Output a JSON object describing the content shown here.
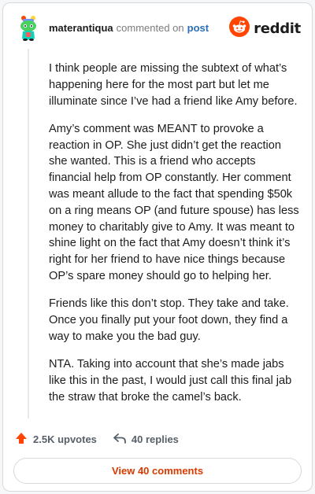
{
  "header": {
    "username": "materantiqua",
    "verb": "commented on",
    "post_link": "post",
    "brand": "reddit"
  },
  "comment": {
    "paragraphs": [
      "I think people are missing the subtext of what’s happening here for the most part but let me illuminate since I’ve had a friend like Amy before.",
      "Amy’s comment was MEANT to provoke a reaction in OP. She just didn’t get the reaction she wanted. This is a friend who accepts financial help from OP constantly. Her comment was meant allude to the fact that spending $50k on a ring means OP (and future spouse) has less money to charitably give to Amy. It was meant to shine light on the fact that Amy doesn’t think it’s right for her friend to have nice things because OP’s spare money should go to helping her.",
      "Friends like this don’t stop. They take and take. Once you finally put your foot down, they find a way to make you the bad guy.",
      "NTA. Taking into account that she’s made jabs like this in the past, I would just call this final jab the straw that broke the camel’s back."
    ]
  },
  "actions": {
    "upvotes": "2.5K upvotes",
    "replies": "40 replies",
    "view_comments": "View 40 comments"
  },
  "colors": {
    "accent": "#ff4500",
    "link": "#2b6fb8",
    "view_button_text": "#d93a00"
  },
  "icons": {
    "avatar": "snoo-avatar-icon",
    "brand": "reddit-logo-icon",
    "upvote": "upvote-arrow-icon",
    "reply": "reply-arrow-icon"
  }
}
